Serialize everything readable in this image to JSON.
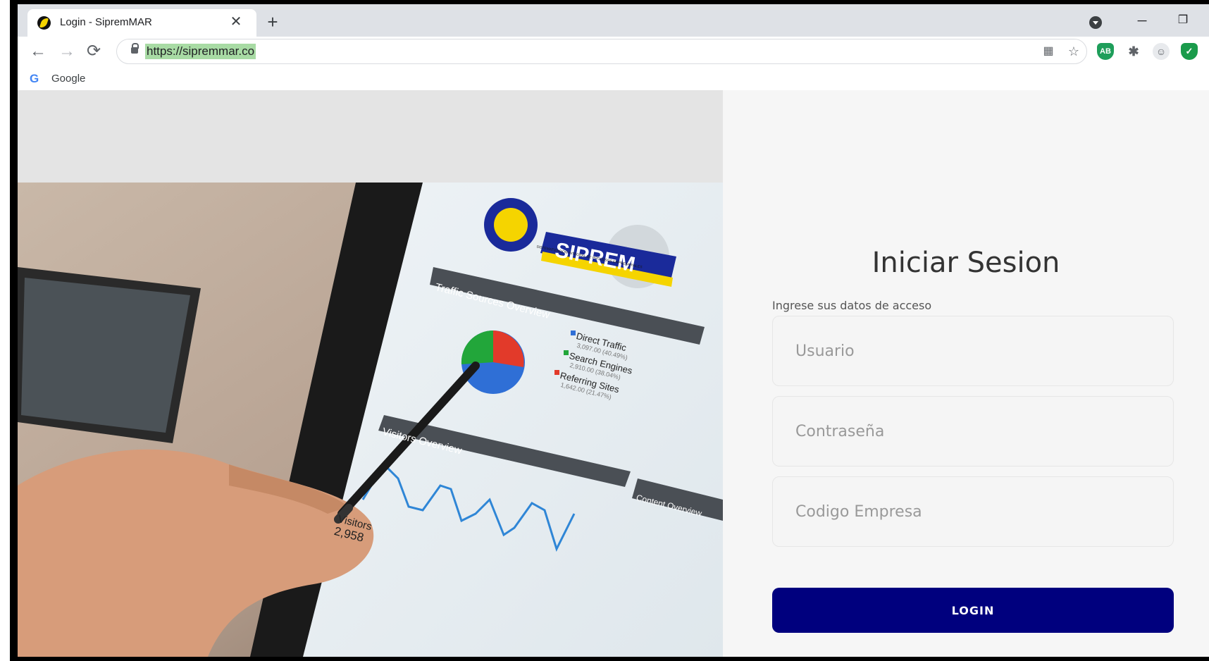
{
  "browser": {
    "tab_title": "Login - SipremMAR",
    "url": "https://sipremmar.co",
    "bookmarks": [
      {
        "label": "Google"
      }
    ]
  },
  "hero": {
    "logo_text": "SIPREM",
    "logo_tagline": "SISTEMATIZACIÓN INTEGRAL DE PROCESOS EMPRESARIALES",
    "panel_traffic": "Traffic Sources Overview",
    "panel_visitors": "Visitors Overview",
    "panel_content": "Content Overview",
    "legend": [
      {
        "name": "Direct Traffic",
        "value": "3,097.00 (40.49%)",
        "color": "#2f6fd6"
      },
      {
        "name": "Search Engines",
        "value": "2,910.00 (38.04%)",
        "color": "#22a63a"
      },
      {
        "name": "Referring Sites",
        "value": "1,642.00 (21.47%)",
        "color": "#e23a2a"
      }
    ],
    "visitors_label": "Visitors",
    "visitors_value": "2,958"
  },
  "login": {
    "title": "Iniciar Sesion",
    "subtitle": "Ingrese sus datos de acceso",
    "user_placeholder": "Usuario",
    "password_placeholder": "Contraseña",
    "company_placeholder": "Codigo Empresa",
    "button_label": "LOGIN",
    "button_color": "#00007e"
  }
}
